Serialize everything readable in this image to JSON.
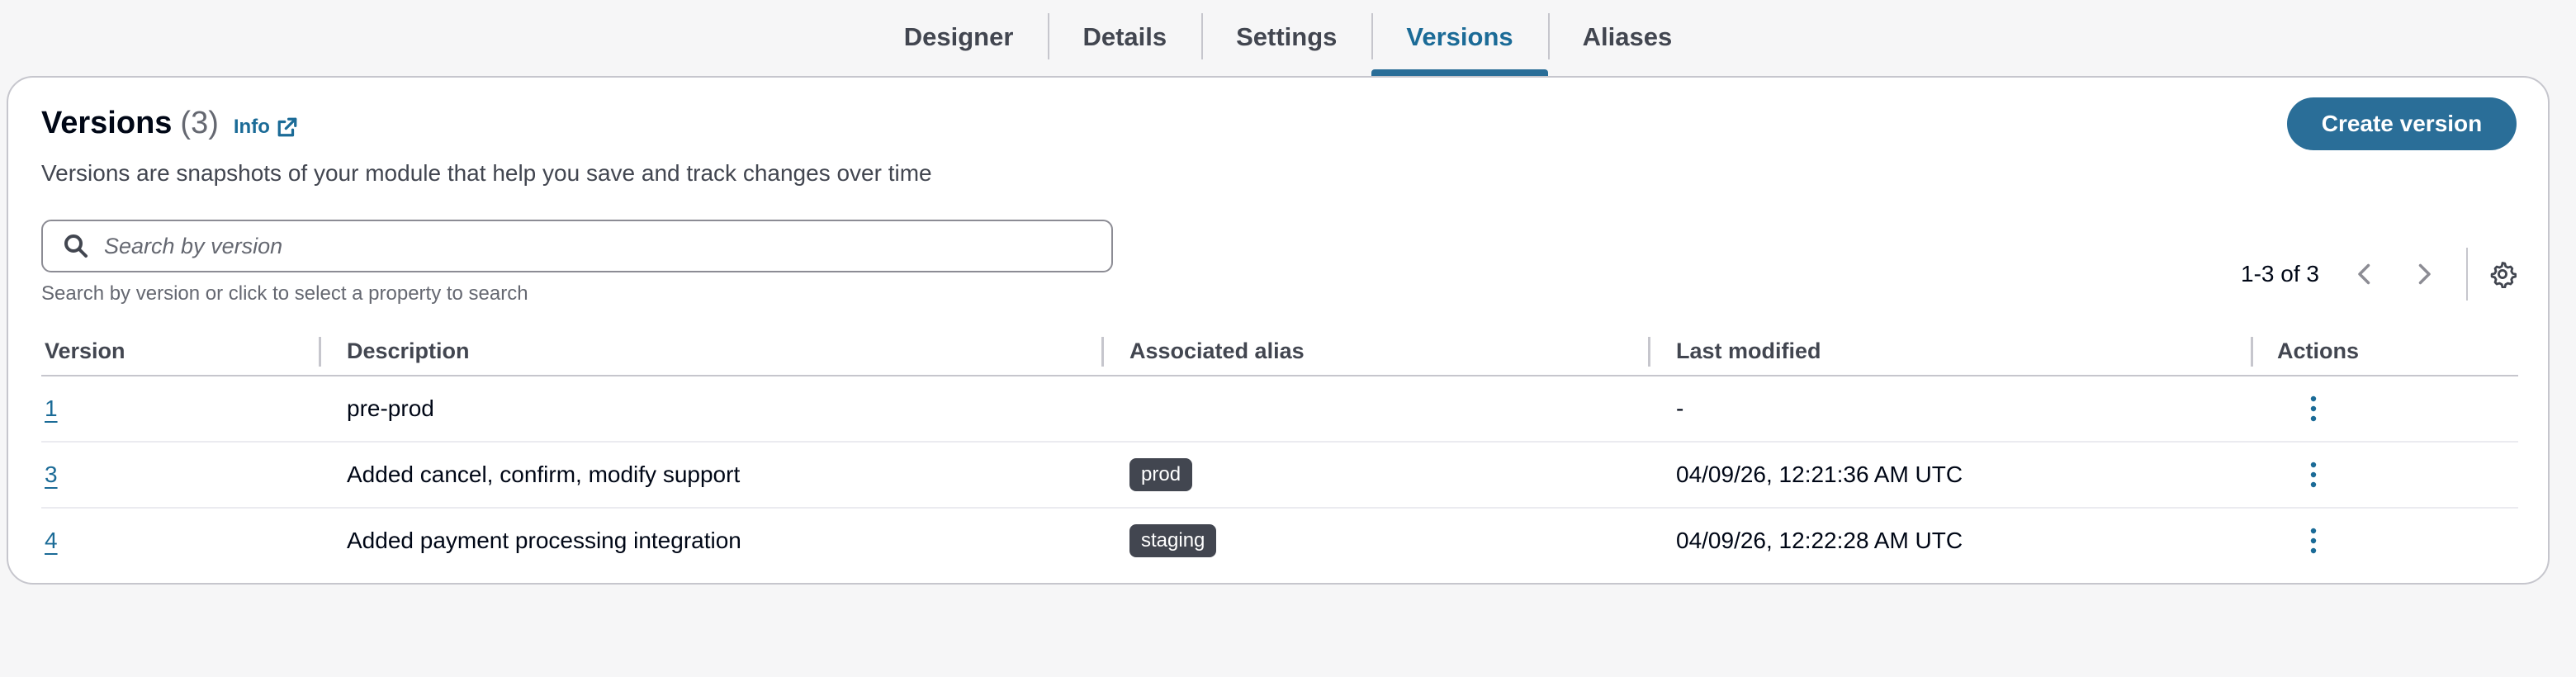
{
  "tabs": [
    {
      "label": "Designer",
      "active": false
    },
    {
      "label": "Details",
      "active": false
    },
    {
      "label": "Settings",
      "active": false
    },
    {
      "label": "Versions",
      "active": true
    },
    {
      "label": "Aliases",
      "active": false
    }
  ],
  "header": {
    "title": "Versions",
    "count": "(3)",
    "info_label": "Info",
    "description": "Versions are snapshots of your module that help you save and track changes over time",
    "create_button": "Create version"
  },
  "search": {
    "placeholder": "Search by version",
    "value": "",
    "hint": "Search by version or click to select a property to search"
  },
  "pagination": {
    "summary": "1-3 of 3"
  },
  "table": {
    "columns": [
      "Version",
      "Description",
      "Associated alias",
      "Last modified",
      "Actions"
    ],
    "rows": [
      {
        "version": "1",
        "description": "pre-prod",
        "alias": "",
        "last_modified": "-"
      },
      {
        "version": "3",
        "description": "Added cancel, confirm, modify support",
        "alias": "prod",
        "last_modified": "04/09/26, 12:21:36 AM UTC"
      },
      {
        "version": "4",
        "description": "Added payment processing integration",
        "alias": "staging",
        "last_modified": "04/09/26, 12:22:28 AM UTC"
      }
    ]
  },
  "colors": {
    "accent": "#2a6e98",
    "link": "#1b6b97",
    "badge_bg": "#424650",
    "background": "#f6f6f7"
  },
  "icons": {
    "info": "external-link-icon",
    "search": "search-icon",
    "prev": "chevron-left-icon",
    "next": "chevron-right-icon",
    "settings": "gear-icon",
    "actions": "vertical-dots-icon"
  }
}
